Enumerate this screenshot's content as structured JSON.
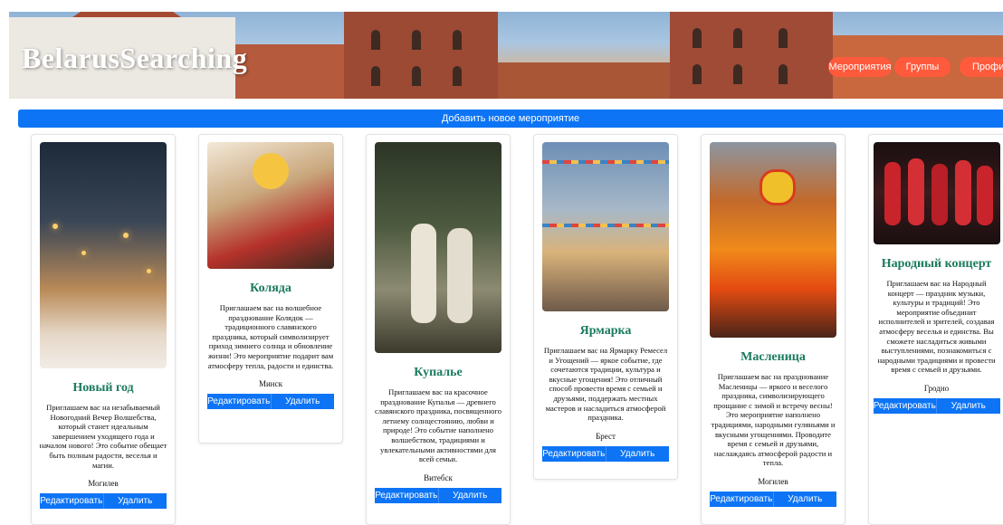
{
  "header": {
    "brand": "BelarusSearching",
    "nav": [
      "Мероприятия",
      "Группы",
      "Профиль"
    ]
  },
  "add_event_label": "Добавить новое мероприятие",
  "actions": {
    "edit": "Редактировать",
    "delete": "Удалить"
  },
  "events": [
    {
      "title": "Новый год",
      "description": "Приглашаем вас на незабываемый Новогодний Вечер Волшебства, который станет идеальным завершением уходящего года и началом нового! Это событие обещает быть полным радости, веселья и магии.",
      "city": "Могилев"
    },
    {
      "title": "Коляда",
      "description": "Приглашаем вас на волшебное празднование Колядок — традиционного славянского праздника, который символизирует приход зимнего солнца и обновление жизни! Это мероприятие подарит вам атмосферу тепла, радости и единства.",
      "city": "Минск"
    },
    {
      "title": "Купалье",
      "description": "Приглашаем вас на красочное празднование Купалья — древнего славянского праздника, посвященного летнему солнцестоянию, любви и природе! Это событие наполнено волшебством, традициями и увлекательными активностями для всей семьи.",
      "city": "Витебск"
    },
    {
      "title": "Ярмарка",
      "description": "Приглашаем вас на Ярмарку Ремесел и Угощений — яркое событие, где сочетаются традиции, культура и вкусные угощения! Это отличный способ провести время с семьей и друзьями, поддержать местных мастеров и насладиться атмосферой праздника.",
      "city": "Брест"
    },
    {
      "title": "Масленица",
      "description": "Приглашаем вас на празднование Масленицы — яркого и веселого праздника, символизирующего прощание с зимой и встречу весны! Это мероприятие наполнено традициями, народными гуляньями и вкусными угощениями. Проводите время с семьей и друзьями, наслаждаясь атмосферой радости и тепла.",
      "city": "Могилев"
    },
    {
      "title": "Народный концерт",
      "description": "Приглашаем вас на Народный концерт — праздник музыки, культуры и традиций! Это мероприятие объединит исполнителей и зрителей, создавая атмосферу веселья и единства. Вы сможете насладиться живыми выступлениями, познакомиться с народными традициями и провести время с семьей и друзьями.",
      "city": "Гродно"
    }
  ],
  "colors": {
    "primary": "#0d74f5",
    "nav": "#ff5a3c",
    "title": "#1a7a5e"
  }
}
